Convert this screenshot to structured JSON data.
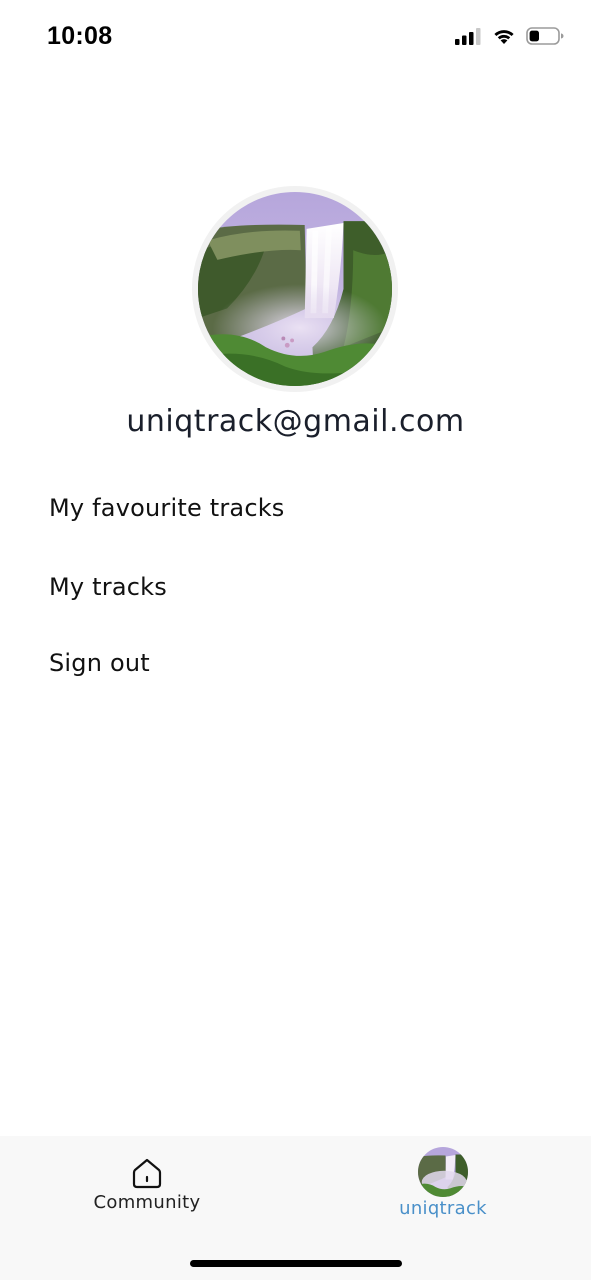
{
  "status_bar": {
    "time": "10:08",
    "icons": [
      "cellular-signal-icon",
      "wifi-icon",
      "battery-icon"
    ],
    "battery_level": 0.35
  },
  "profile": {
    "avatar": "waterfall-avatar",
    "email": "uniqtrack@gmail.com"
  },
  "menu": {
    "items": [
      {
        "label": "My favourite tracks"
      },
      {
        "label": "My tracks"
      },
      {
        "label": "Sign out"
      }
    ]
  },
  "tab_bar": {
    "tabs": [
      {
        "label": "Community",
        "icon": "home-icon",
        "active": false
      },
      {
        "label": "uniqtrack",
        "icon": "avatar-icon",
        "active": true
      }
    ],
    "active_color": "#4a90c9",
    "inactive_color": "#222222"
  }
}
